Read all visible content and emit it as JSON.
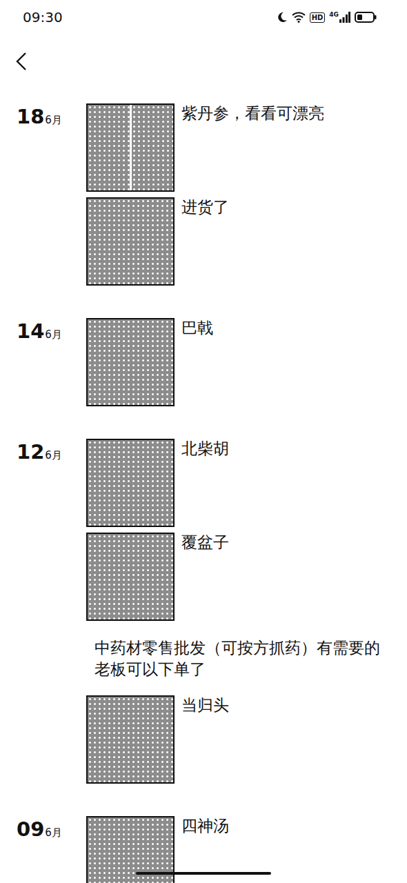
{
  "status_bar": {
    "time": "09:30",
    "hd": "HD",
    "network": "4G"
  },
  "groups": [
    {
      "day": "18",
      "month": "6月",
      "posts": [
        {
          "kind": "double-photo",
          "caption": "紫丹参，看看可漂亮"
        },
        {
          "kind": "photo",
          "caption": "进货了"
        }
      ]
    },
    {
      "day": "14",
      "month": "6月",
      "posts": [
        {
          "kind": "photo",
          "caption": "巴戟"
        }
      ]
    },
    {
      "day": "12",
      "month": "6月",
      "posts": [
        {
          "kind": "photo",
          "caption": "北柴胡"
        },
        {
          "kind": "photo",
          "caption": "覆盆子"
        },
        {
          "kind": "text",
          "caption": "中药材零售批发（可按方抓药）有需要的老板可以下单了"
        },
        {
          "kind": "photo",
          "caption": "当归头"
        }
      ]
    },
    {
      "day": "09",
      "month": "6月",
      "posts": [
        {
          "kind": "photo",
          "caption": "四神汤"
        }
      ]
    }
  ]
}
